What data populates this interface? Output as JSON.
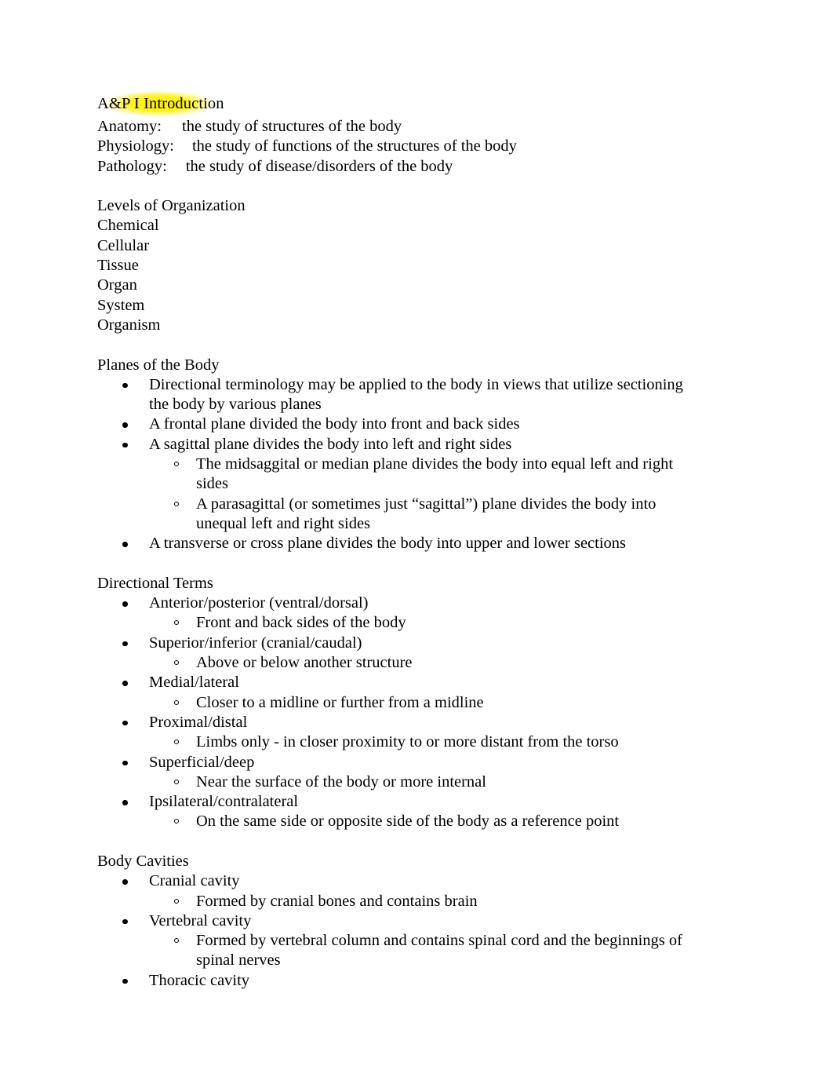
{
  "document": {
    "title": "A&P I Introduction",
    "title_highlight_color": "#FFEE00",
    "page_background": "#FFFFFF",
    "text_color": "#000000",
    "heading_shade_color": "#EDEDED"
  },
  "definitions": [
    {
      "term": "Anatomy:",
      "definition": "the study of structures of the body"
    },
    {
      "term": "Physiology:",
      "definition": "the study of functions of the structures of the body"
    },
    {
      "term": "Pathology:",
      "definition": "the study of disease/disorders of the body"
    }
  ],
  "sections": {
    "levels_of_organization": {
      "heading": "Levels of Organization",
      "items": [
        "Chemical",
        "Cellular",
        "Tissue",
        "Organ",
        "System",
        "Organism"
      ]
    },
    "planes_of_the_body": {
      "heading": "Planes of the Body",
      "bullets": [
        {
          "text": "Directional terminology may be applied to the body in views that utilize sectioning the body by various planes",
          "sub": []
        },
        {
          "text": "A frontal plane divided the body into front and back sides",
          "sub": []
        },
        {
          "text": "A sagittal plane divides the body into left and right sides",
          "sub": [
            "The midsaggital or median plane divides the body into equal left and right sides",
            "A parasagittal (or sometimes just “sagittal”) plane divides the body into unequal left and right sides"
          ]
        },
        {
          "text": "A transverse or cross plane divides the body into upper and lower sections",
          "sub": []
        }
      ]
    },
    "directional_terms": {
      "heading": "Directional Terms",
      "bullets": [
        {
          "text": "Anterior/posterior (ventral/dorsal)",
          "sub": [
            "Front and back sides of the body"
          ]
        },
        {
          "text": "Superior/inferior (cranial/caudal)",
          "sub": [
            "Above or below another structure"
          ]
        },
        {
          "text": "Medial/lateral",
          "sub": [
            "Closer to a midline or further from a midline"
          ]
        },
        {
          "text": "Proximal/distal",
          "sub": [
            "Limbs only - in closer proximity to or more distant from the torso"
          ]
        },
        {
          "text": "Superficial/deep",
          "sub": [
            "Near the surface of the body or more internal"
          ]
        },
        {
          "text": "Ipsilateral/contralateral",
          "sub": [
            "On the same side or opposite side of the body as a reference point"
          ]
        }
      ]
    },
    "body_cavities": {
      "heading": "Body Cavities",
      "bullets": [
        {
          "text": "Cranial cavity",
          "sub": [
            "Formed by cranial bones and contains brain"
          ]
        },
        {
          "text": "Vertebral cavity",
          "sub": [
            "Formed by vertebral column and contains spinal cord and the beginnings of spinal nerves"
          ]
        },
        {
          "text": "Thoracic cavity",
          "sub": []
        }
      ]
    }
  }
}
